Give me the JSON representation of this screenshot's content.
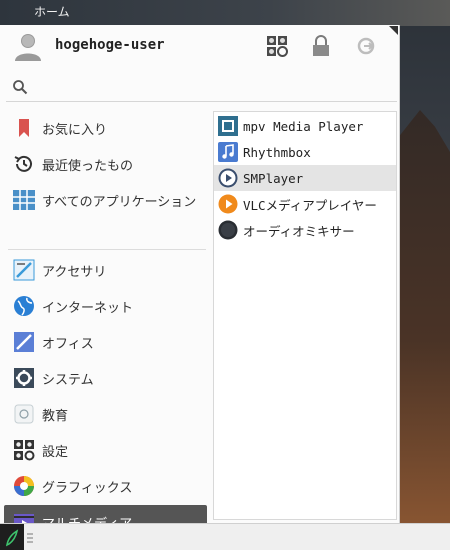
{
  "desktop": {
    "home_label": "ホーム"
  },
  "user": {
    "name": "hogehoge-user"
  },
  "header_buttons": [
    {
      "name": "settings-manager",
      "icon": "settings-grid-icon"
    },
    {
      "name": "lock-screen",
      "icon": "lock-icon"
    },
    {
      "name": "logout",
      "icon": "logout-icon"
    }
  ],
  "search": {
    "value": "",
    "placeholder": ""
  },
  "categories": [
    {
      "label": "お気に入り",
      "icon": "bookmark-icon",
      "color": "#d9534f"
    },
    {
      "label": "最近使ったもの",
      "icon": "history-icon",
      "color": "#333333"
    },
    {
      "label": "すべてのアプリケーション",
      "icon": "grid-apps-icon",
      "color": "#4a90c8"
    },
    {
      "label": "アクセサリ",
      "icon": "accessories-icon",
      "color": "#3a9ad9"
    },
    {
      "label": "インターネット",
      "icon": "globe-icon",
      "color": "#2a7fd4"
    },
    {
      "label": "オフィス",
      "icon": "office-icon",
      "color": "#5b7fd6"
    },
    {
      "label": "システム",
      "icon": "system-gear-icon",
      "color": "#3b4a5a"
    },
    {
      "label": "教育",
      "icon": "education-icon",
      "color": "#8fa0a8"
    },
    {
      "label": "設定",
      "icon": "settings-icon",
      "color": "#333333"
    },
    {
      "label": "グラフィックス",
      "icon": "graphics-icon",
      "color": "#e04a3a"
    },
    {
      "label": "マルチメディア",
      "icon": "multimedia-icon",
      "color": "#6a58c8",
      "selected": true
    }
  ],
  "apps": [
    {
      "label": "mpv Media Player",
      "icon": "mpv-icon",
      "color": "#2f6f8f"
    },
    {
      "label": "Rhythmbox",
      "icon": "rhythmbox-icon",
      "color": "#4a7bd0"
    },
    {
      "label": "SMPlayer",
      "icon": "smplayer-icon",
      "color": "#3a4e6e",
      "hover": true
    },
    {
      "label": "VLCメディアプレイヤー",
      "icon": "vlc-icon",
      "color": "#f08a1c"
    },
    {
      "label": "オーディオミキサー",
      "icon": "audio-mixer-icon",
      "color": "#2a2e33"
    }
  ],
  "taskbar": {
    "menu_icon": "whisker-menu-icon",
    "accent": "#3ec46d"
  }
}
